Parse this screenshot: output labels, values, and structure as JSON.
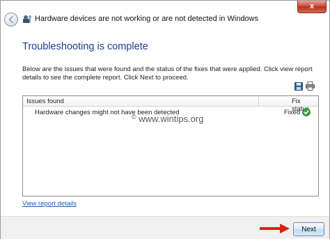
{
  "window": {
    "title": "Hardware devices are not working or are not detected in Windows",
    "close_label": "x"
  },
  "page": {
    "heading": "Troubleshooting is complete",
    "description": "Below are the issues that were found and the status of the fixes that were applied. Click view report details to see the complete report. Click Next to proceed."
  },
  "table": {
    "columns": [
      "Issues found",
      "Fix status"
    ],
    "rows": [
      {
        "issue": "Hardware changes might not have been detected",
        "status": "Fixed",
        "status_icon": "green-check-icon"
      }
    ]
  },
  "watermark": {
    "symbol": "©",
    "text": "www.wintips.org"
  },
  "links": {
    "view_report": "View report details"
  },
  "footer": {
    "next_label": "Next"
  },
  "colors": {
    "heading": "#1e3e8a",
    "link": "#1a5fb4",
    "close_button": "#c8452f",
    "fixed_check": "#3aa53a",
    "arrow": "#d8201a"
  },
  "icons": {
    "back": "back-arrow-icon",
    "wizard": "troubleshooter-icon",
    "save": "save-icon",
    "print": "print-icon"
  }
}
